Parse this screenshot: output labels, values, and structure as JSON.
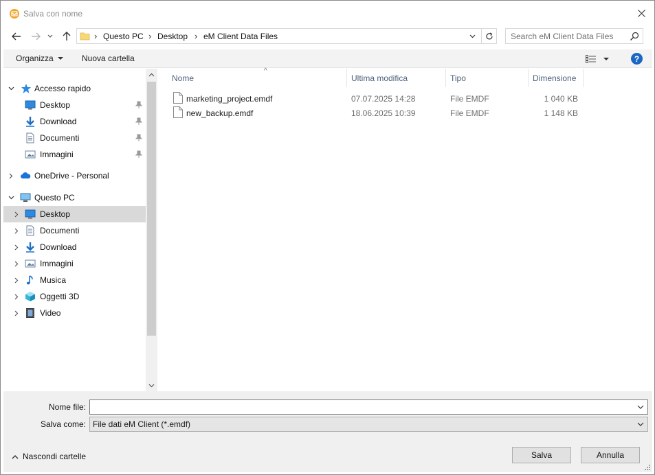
{
  "window": {
    "title": "Salva con nome",
    "accent_color": "#f2a42d"
  },
  "address": {
    "crumbs": [
      "Questo PC",
      "Desktop",
      "eM Client Data Files"
    ]
  },
  "search": {
    "placeholder": "Search eM Client Data Files"
  },
  "toolbar": {
    "organize_label": "Organizza",
    "new_folder_label": "Nuova cartella",
    "help_label": "?"
  },
  "nav": {
    "quick_access": {
      "label": "Accesso rapido",
      "items": [
        {
          "label": "Desktop",
          "icon": "desktop-icon"
        },
        {
          "label": "Download",
          "icon": "download-icon"
        },
        {
          "label": "Documenti",
          "icon": "documents-icon"
        },
        {
          "label": "Immagini",
          "icon": "pictures-icon"
        }
      ]
    },
    "onedrive": {
      "label": "OneDrive - Personal"
    },
    "this_pc": {
      "label": "Questo PC",
      "items": [
        {
          "label": "Desktop",
          "icon": "desktop-icon",
          "selected": true
        },
        {
          "label": "Documenti",
          "icon": "documents-icon"
        },
        {
          "label": "Download",
          "icon": "download-icon"
        },
        {
          "label": "Immagini",
          "icon": "pictures-icon"
        },
        {
          "label": "Musica",
          "icon": "music-icon"
        },
        {
          "label": "Oggetti 3D",
          "icon": "3d-objects-icon"
        },
        {
          "label": "Video",
          "icon": "video-icon"
        }
      ]
    }
  },
  "files": {
    "columns": [
      "Nome",
      "Ultima modifica",
      "Tipo",
      "Dimensione"
    ],
    "rows": [
      {
        "name": "marketing_project.emdf",
        "modified": "07.07.2025 14:28",
        "type": "File EMDF",
        "size": "1 040 KB"
      },
      {
        "name": "new_backup.emdf",
        "modified": "18.06.2025 10:39",
        "type": "File EMDF",
        "size": "1 148 KB"
      }
    ]
  },
  "footer": {
    "filename_label": "Nome file:",
    "filename_value": "",
    "save_as_label": "Salva come:",
    "save_as_value": "File dati eM Client (*.emdf)",
    "hide_folders_label": "Nascondi cartelle",
    "save_label": "Salva",
    "cancel_label": "Annulla"
  }
}
